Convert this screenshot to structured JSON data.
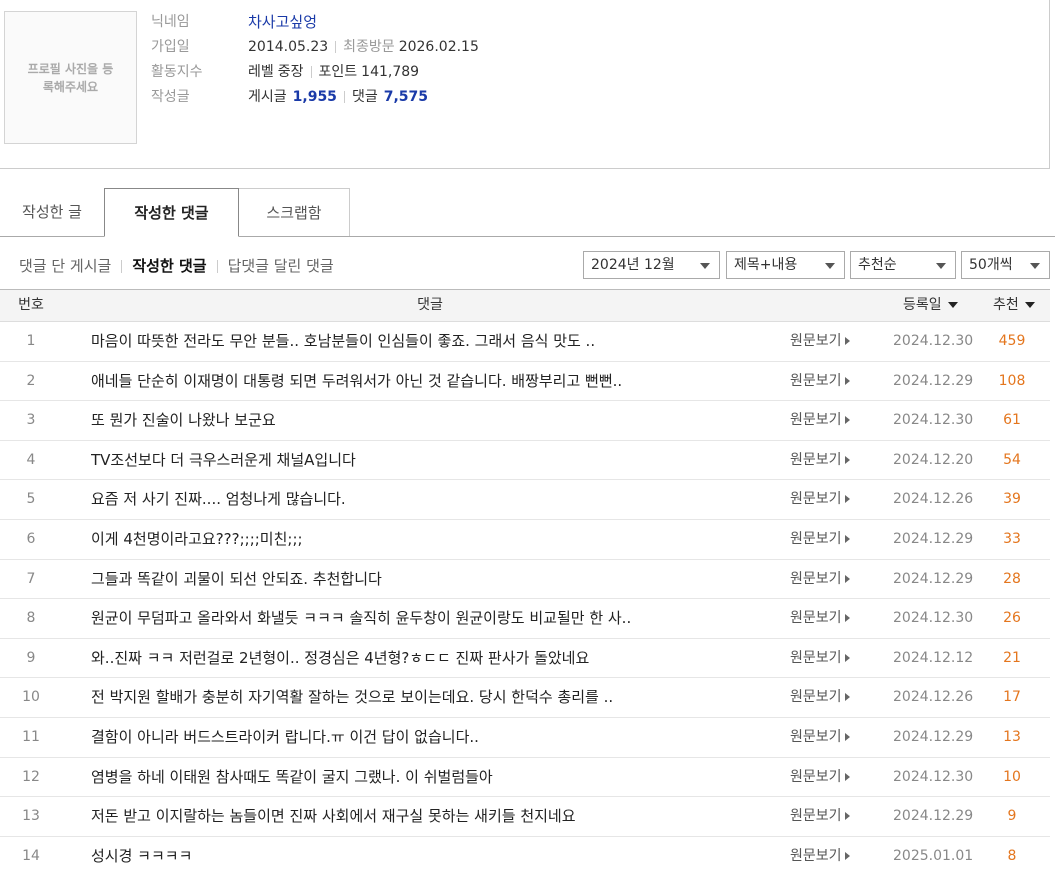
{
  "profile": {
    "photo_text": "프로필 사진을 등록해주세요",
    "labels": {
      "nickname": "닉네임",
      "joined": "가입일",
      "activity": "활동지수",
      "posts": "작성글"
    },
    "nickname": "차사고싶엉",
    "joined_date": "2014.05.23",
    "last_visit_label": "최종방문",
    "last_visit_date": "2026.02.15",
    "level_label": "레벨",
    "level_value": "중장",
    "point_label": "포인트",
    "point_value": "141,789",
    "posts_label": "게시글",
    "posts_count": "1,955",
    "comments_label": "댓글",
    "comments_count": "7,575"
  },
  "tabs": [
    {
      "label": "작성한 글",
      "active": false
    },
    {
      "label": "작성한 댓글",
      "active": true
    },
    {
      "label": "스크랩함",
      "active": false
    }
  ],
  "subtabs": [
    {
      "label": "댓글 단 게시글",
      "active": false
    },
    {
      "label": "작성한 댓글",
      "active": true
    },
    {
      "label": "답댓글 달린 댓글",
      "active": false
    }
  ],
  "filters": {
    "month": "2024년 12월",
    "search_scope": "제목+내용",
    "sort": "추천순",
    "page_size": "50개씩"
  },
  "table": {
    "headers": {
      "num": "번호",
      "comment": "댓글",
      "date": "등록일",
      "recommend": "추천"
    },
    "original_link_label": "원문보기",
    "rows": [
      {
        "num": "1",
        "text": "마음이 따뜻한 전라도 무안 분들.. 호남분들이 인심들이 좋죠. 그래서 음식 맛도 ..",
        "date": "2024.12.30",
        "rec": "459"
      },
      {
        "num": "2",
        "text": "애네들 단순히 이재명이 대통령 되면 두려워서가 아닌 것 같습니다. 배짱부리고 뻔뻔..",
        "date": "2024.12.29",
        "rec": "108"
      },
      {
        "num": "3",
        "text": "또 뭔가 진술이 나왔나 보군요",
        "date": "2024.12.30",
        "rec": "61"
      },
      {
        "num": "4",
        "text": "TV조선보다 더 극우스러운게 채널A입니다",
        "date": "2024.12.20",
        "rec": "54"
      },
      {
        "num": "5",
        "text": "요즘 저 사기 진짜.... 엄청나게 많습니다.",
        "date": "2024.12.26",
        "rec": "39"
      },
      {
        "num": "6",
        "text": "이게 4천명이라고요???;;;;미친;;;",
        "date": "2024.12.29",
        "rec": "33"
      },
      {
        "num": "7",
        "text": "그들과 똑같이 괴물이 되선 안되죠. 추천합니다",
        "date": "2024.12.29",
        "rec": "28"
      },
      {
        "num": "8",
        "text": "원균이 무덤파고 올라와서 화낼듯 ㅋㅋㅋ 솔직히 윤두창이 원균이랑도 비교될만 한 사..",
        "date": "2024.12.30",
        "rec": "26"
      },
      {
        "num": "9",
        "text": "와..진짜 ㅋㅋ 저런걸로 2년형이.. 정경심은 4년형?ㅎㄷㄷ 진짜 판사가 돌았네요",
        "date": "2024.12.12",
        "rec": "21"
      },
      {
        "num": "10",
        "text": "전 박지원 할배가 충분히 자기역활 잘하는 것으로 보이는데요. 당시 한덕수 총리를 ..",
        "date": "2024.12.26",
        "rec": "17"
      },
      {
        "num": "11",
        "text": "결함이 아니라 버드스트라이커 랍니다.ㅠ 이건 답이 없습니다..",
        "date": "2024.12.29",
        "rec": "13"
      },
      {
        "num": "12",
        "text": "염병을 하네 이태원 참사때도 똑같이 굴지 그랬나. 이 쉬벌럼들아",
        "date": "2024.12.30",
        "rec": "10"
      },
      {
        "num": "13",
        "text": "저돈 받고 이지랄하는 놈들이면 진짜 사회에서 재구실 못하는 새키들 천지네요",
        "date": "2024.12.29",
        "rec": "9"
      },
      {
        "num": "14",
        "text": "성시경 ㅋㅋㅋㅋ",
        "date": "2025.01.01",
        "rec": "8"
      }
    ]
  },
  "colors": {
    "accent_blue": "#1a3aa8",
    "recommend_orange": "#e4761e"
  }
}
